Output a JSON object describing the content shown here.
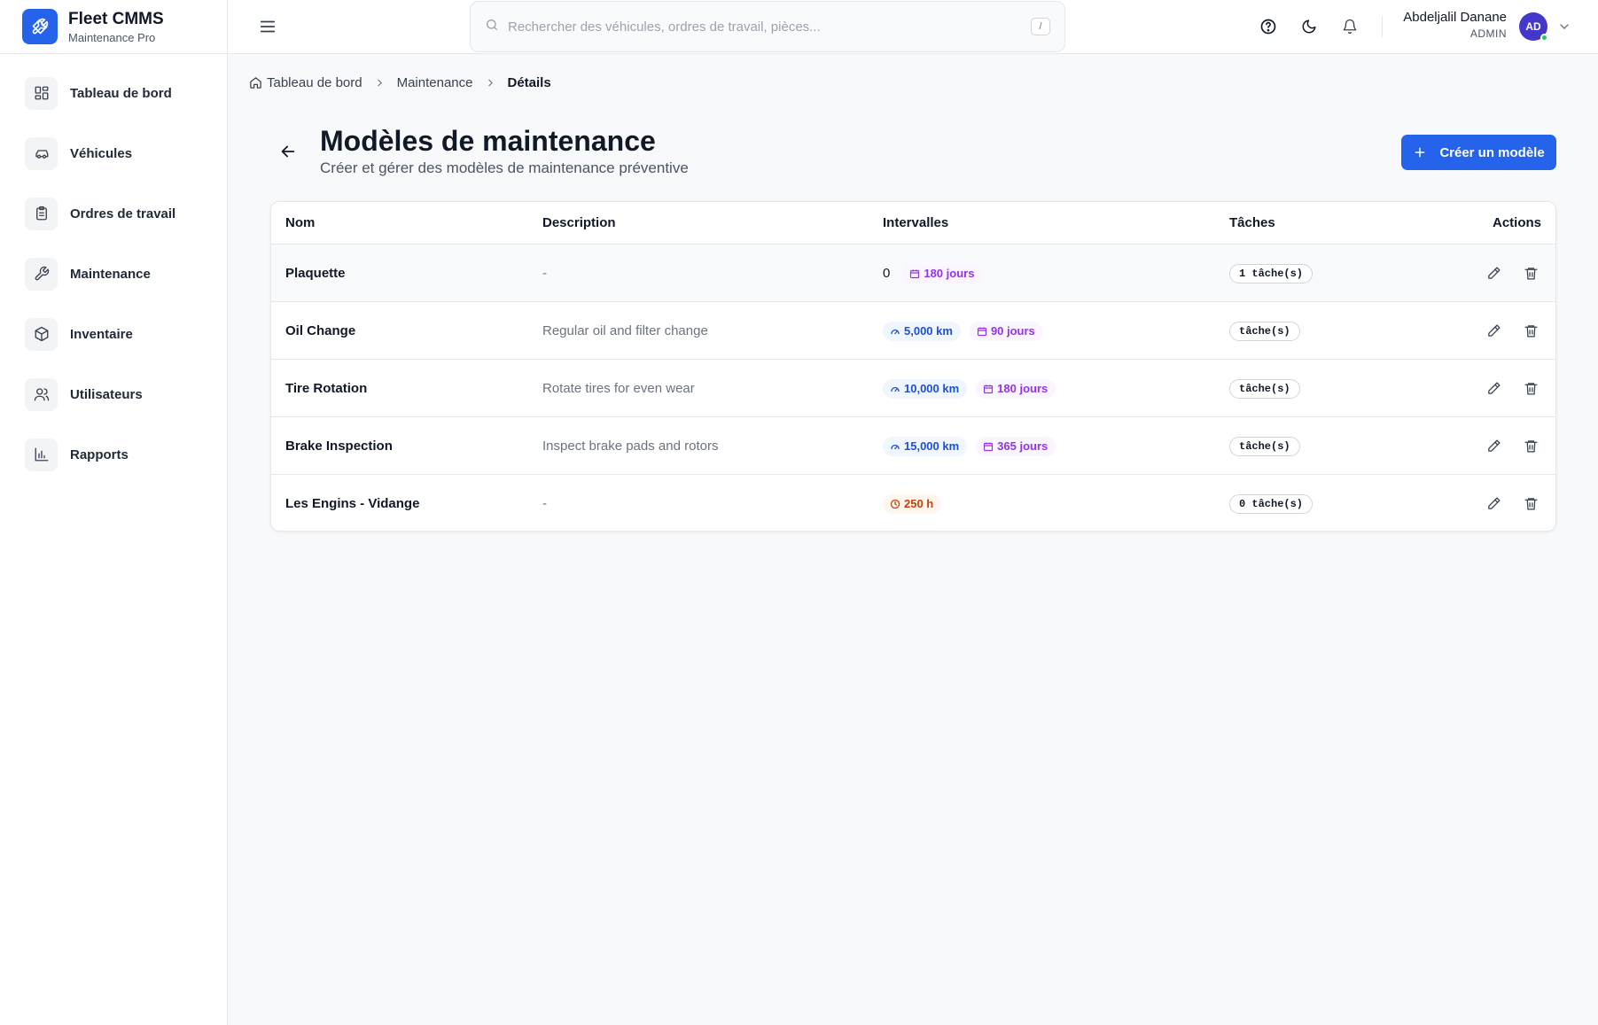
{
  "brand": {
    "title": "Fleet CMMS",
    "subtitle": "Maintenance Pro",
    "icon": "wrench-icon",
    "color": "#2563eb"
  },
  "sidebar": {
    "items": [
      {
        "label": "Tableau de bord",
        "icon": "dashboard-icon"
      },
      {
        "label": "Véhicules",
        "icon": "car-icon"
      },
      {
        "label": "Ordres de travail",
        "icon": "clipboard-icon"
      },
      {
        "label": "Maintenance",
        "icon": "wrench-icon"
      },
      {
        "label": "Inventaire",
        "icon": "package-icon"
      },
      {
        "label": "Utilisateurs",
        "icon": "users-icon"
      },
      {
        "label": "Rapports",
        "icon": "bar-chart-icon"
      }
    ]
  },
  "header": {
    "search_placeholder": "Rechercher des véhicules, ordres de travail, pièces...",
    "search_shortcut": "/",
    "user": {
      "name": "Abdeljalil Danane",
      "role": "ADMIN",
      "initials": "AD",
      "status_color": "#22c55e"
    }
  },
  "breadcrumb": {
    "home": "Tableau de bord",
    "parent": "Maintenance",
    "current": "Détails"
  },
  "page": {
    "title": "Modèles de maintenance",
    "subtitle": "Créer et gérer des modèles de maintenance préventive",
    "create_label": "Créer un modèle"
  },
  "table": {
    "columns": {
      "name": "Nom",
      "description": "Description",
      "intervals": "Intervalles",
      "tasks": "Tâches",
      "actions": "Actions"
    },
    "rows": [
      {
        "name": "Plaquette",
        "description": "-",
        "km": "",
        "plain": "0",
        "days": "180 jours",
        "hours": "",
        "tasks": "1 tâche(s)"
      },
      {
        "name": "Oil Change",
        "description": "Regular oil and filter change",
        "km": "5,000 km",
        "plain": "",
        "days": "90 jours",
        "hours": "",
        "tasks": "tâche(s)"
      },
      {
        "name": "Tire Rotation",
        "description": "Rotate tires for even wear",
        "km": "10,000 km",
        "plain": "",
        "days": "180 jours",
        "hours": "",
        "tasks": "tâche(s)"
      },
      {
        "name": "Brake Inspection",
        "description": "Inspect brake pads and rotors",
        "km": "15,000 km",
        "plain": "",
        "days": "365 jours",
        "hours": "",
        "tasks": "tâche(s)"
      },
      {
        "name": "Les Engins - Vidange",
        "description": "-",
        "km": "",
        "plain": "",
        "days": "",
        "hours": "250 h",
        "tasks": "0 tâche(s)"
      }
    ]
  },
  "colors": {
    "accent": "#2563eb",
    "km": "#1d4ed8",
    "days": "#9333ea",
    "hours": "#c2410c"
  }
}
